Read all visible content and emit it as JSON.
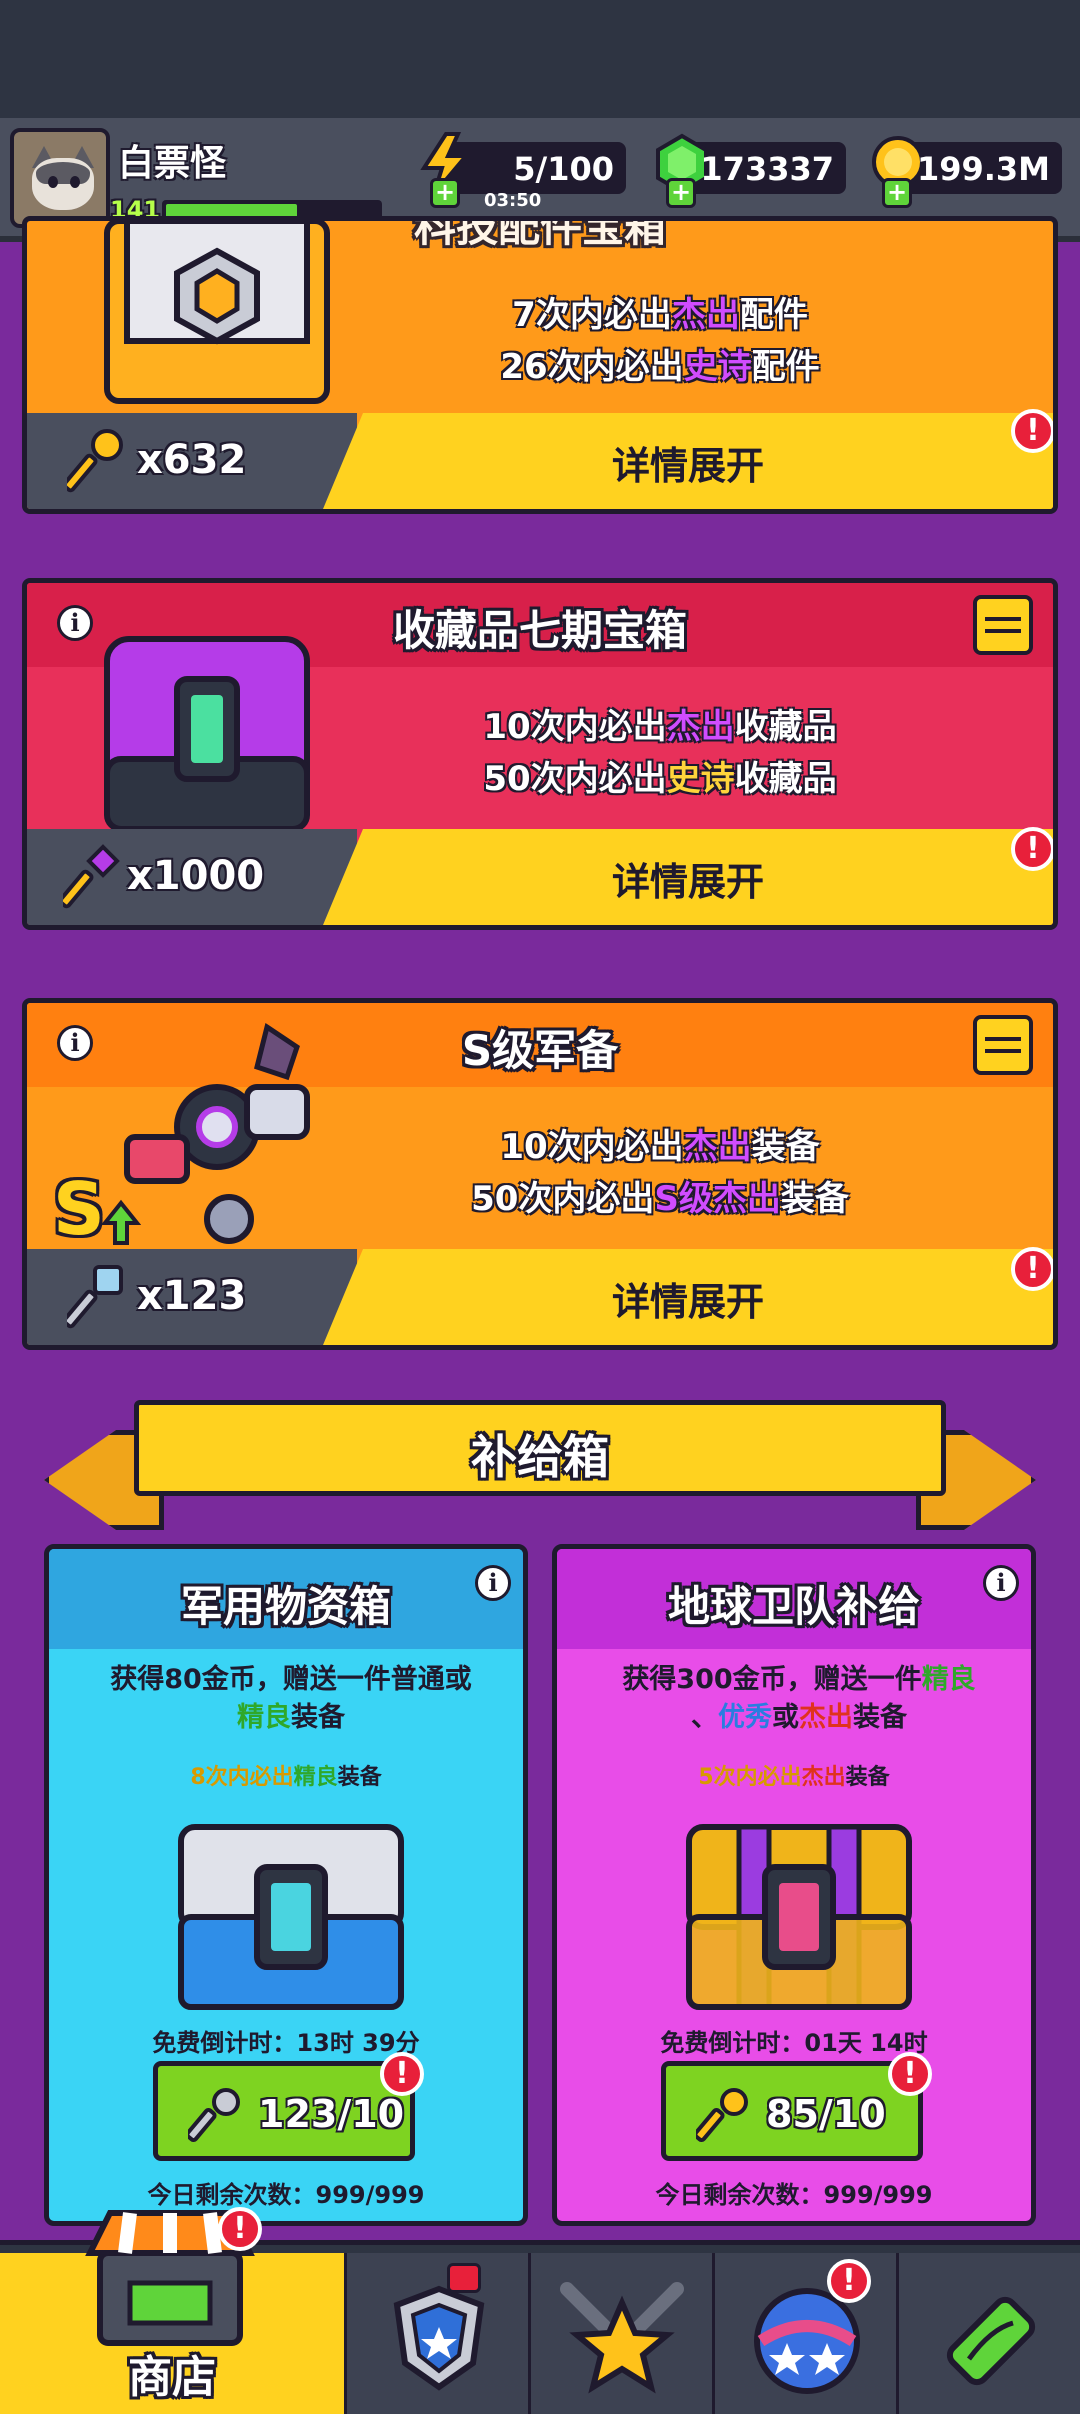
{
  "player": {
    "name": "白票怪",
    "level": "141",
    "xp_fraction": 0.62
  },
  "resources": {
    "energy": "5/100",
    "energy_timer": "03:50",
    "gems": "173337",
    "coins": "199.3M"
  },
  "cards": [
    {
      "title": "科技配件宝箱",
      "line1": {
        "pre": "7次内必出",
        "hl": "杰出",
        "post": "配件"
      },
      "line2": {
        "pre": "26次内必出",
        "hl": "史诗",
        "post": "配件"
      },
      "key_count": "x632",
      "detail": "详情展开",
      "alert": "!"
    },
    {
      "title": "收藏品七期宝箱",
      "line1": {
        "pre": "10次内必出",
        "hl": "杰出",
        "post": "收藏品"
      },
      "line2": {
        "pre": "50次内必出",
        "hl": "史诗",
        "post": "收藏品"
      },
      "key_count": "x1000",
      "detail": "详情展开",
      "alert": "!",
      "info": "i"
    },
    {
      "title": "S级军备",
      "line1": {
        "pre": "10次内必出",
        "hl": "杰出",
        "post": "装备"
      },
      "line2": {
        "pre": "50次内必出",
        "hl": "S级杰出",
        "post": "装备"
      },
      "key_count": "x123",
      "detail": "详情展开",
      "alert": "!",
      "info": "i",
      "grade": "S"
    }
  ],
  "banner": {
    "title": "补给箱"
  },
  "supply": [
    {
      "title": "军用物资箱",
      "desc_a": "获得80金币，赠送一件普通或",
      "desc_b_hl": "精良",
      "desc_b_post": "装备",
      "pity_pre": "8次内必出",
      "pity_hl": "精良",
      "pity_post": "装备",
      "free_cd": "免费倒计时：13时 39分",
      "keys": "123/10",
      "daily": "今日剩余次数：999/999",
      "info": "i",
      "alert": "!"
    },
    {
      "title": "地球卫队补给",
      "desc_a_pre": "获得300金币，赠送一件",
      "desc_a_hl": "精良",
      "desc_b_pre": "、",
      "desc_b_hl1": "优秀",
      "desc_b_mid": "或",
      "desc_b_hl2": "杰出",
      "desc_b_post": "装备",
      "pity_pre": "5次内必出",
      "pity_hl": "杰出",
      "pity_post": "装备",
      "free_cd": "免费倒计时：01天 14时",
      "keys": "85/10",
      "daily": "今日剩余次数：999/999",
      "info": "i",
      "alert": "!"
    }
  ],
  "nav": [
    {
      "label": "商店",
      "icon": "shop-icon",
      "active": true,
      "alert": "!"
    },
    {
      "label": "",
      "icon": "shield-icon"
    },
    {
      "label": "",
      "icon": "star-swords-icon"
    },
    {
      "label": "",
      "icon": "planet-icon",
      "alert": "!"
    },
    {
      "label": "",
      "icon": "dna-icon"
    }
  ],
  "colors": {
    "background": "#7a2a9c",
    "card1": "#ff9a1a",
    "card2": "#e8305a",
    "card3": "#ff9a1a",
    "supply_blue": "#3ad4f5",
    "supply_pink": "#e84de8",
    "button_yellow": "#ffd21f",
    "button_green": "#7ed321"
  }
}
